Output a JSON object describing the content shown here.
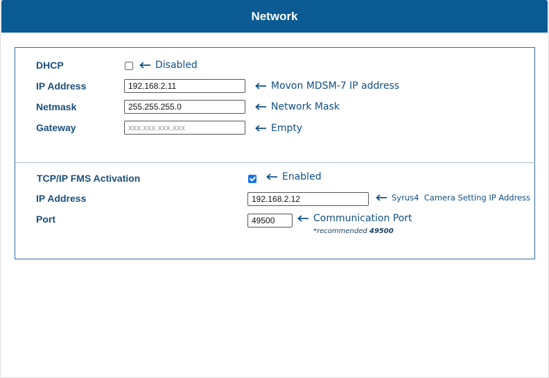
{
  "header": {
    "title": "Network"
  },
  "network": {
    "dhcp": {
      "label": "DHCP",
      "checked": false,
      "note": "Disabled"
    },
    "ip_address": {
      "label": "IP Address",
      "value": "192.168.2.11",
      "note": "Movon MDSM-7 IP address"
    },
    "netmask": {
      "label": "Netmask",
      "value": "255.255.255.0",
      "note": "Network Mask"
    },
    "gateway": {
      "label": "Gateway",
      "value": "",
      "placeholder": "xxx.xxx.xxx.xxx",
      "note": "Empty"
    }
  },
  "fms": {
    "activation": {
      "label": "TCP/IP FMS Activation",
      "checked": true,
      "note": "Enabled"
    },
    "ip_address": {
      "label": "IP Address",
      "value": "192.168.2.12",
      "note": "Syrus4  Camera Setting IP Address"
    },
    "port": {
      "label": "Port",
      "value": "49500",
      "note": "Communication Port",
      "recommended_prefix": "*recommended ",
      "recommended_value": "49500"
    }
  },
  "colors": {
    "header": "#0a5a93",
    "annotation": "#0f4f86",
    "label": "#1a4f7c",
    "checkbox_on": "#1a73e8"
  },
  "icons": {
    "annotation_arrow": "left-arrow-icon"
  }
}
